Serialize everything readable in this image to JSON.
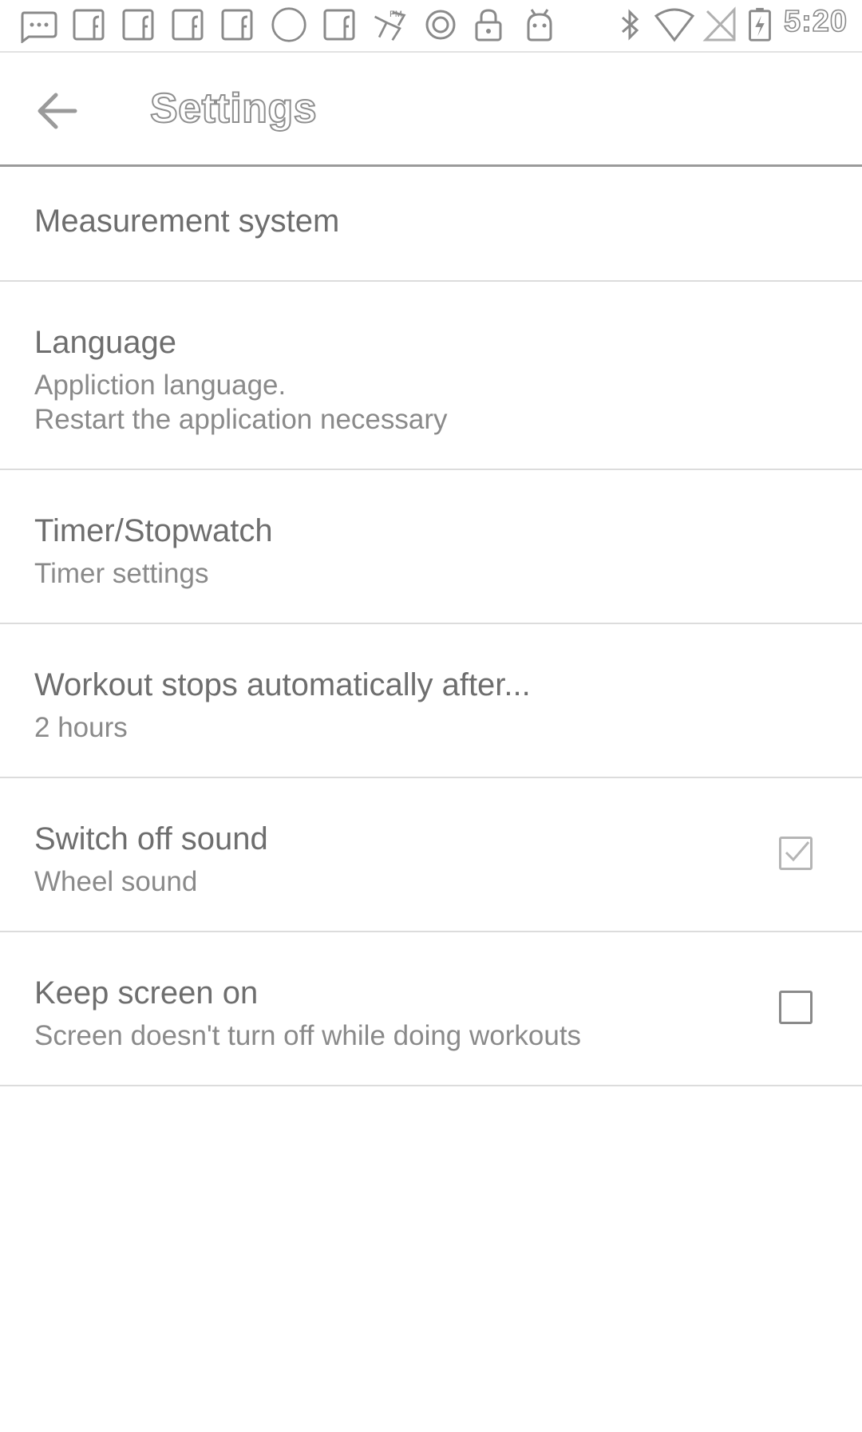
{
  "status_bar": {
    "time": "5:20",
    "left_icons": [
      "message-icon",
      "facebook-icon",
      "facebook-icon",
      "facebook-icon",
      "facebook-icon",
      "circle-icon",
      "facebook-icon",
      "game-icon",
      "vpn-icon",
      "lock-icon",
      "android-icon"
    ],
    "right_icons": [
      "bluetooth-icon",
      "wifi-icon",
      "no-sim-icon",
      "battery-charging-icon"
    ]
  },
  "app_bar": {
    "title": "Settings",
    "back_icon": "arrow-back-icon"
  },
  "settings": {
    "items": [
      {
        "title": "Measurement system"
      },
      {
        "title": "Language",
        "subtitle_line1": "Appliction language.",
        "subtitle_line2": "Restart the application necessary"
      },
      {
        "title": "Timer/Stopwatch",
        "subtitle": "Timer settings"
      },
      {
        "title": "Workout stops automatically after...",
        "subtitle": "2 hours"
      },
      {
        "title": "Switch off sound",
        "subtitle": "Wheel sound",
        "checked": true
      },
      {
        "title": "Keep screen on",
        "subtitle": "Screen doesn't turn off while doing workouts",
        "checked": false
      }
    ]
  }
}
